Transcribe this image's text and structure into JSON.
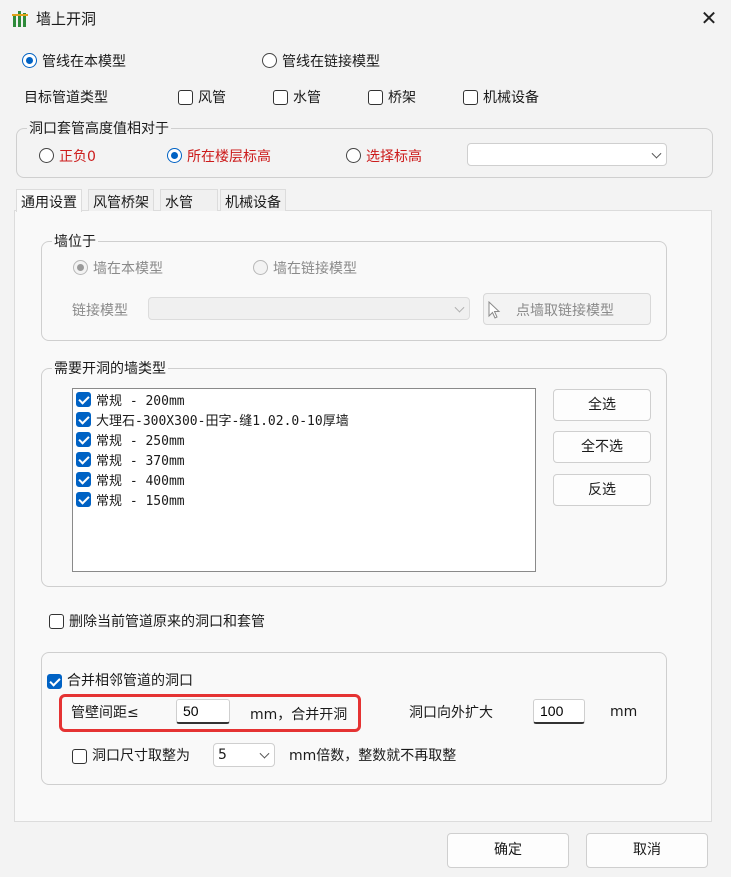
{
  "window": {
    "title": "墙上开洞"
  },
  "source": {
    "options": [
      "管线在本模型",
      "管线在链接模型"
    ],
    "selected": 0
  },
  "pipe_types": {
    "label": "目标管道类型",
    "items": [
      {
        "label": "风管",
        "checked": false
      },
      {
        "label": "水管",
        "checked": false
      },
      {
        "label": "桥架",
        "checked": false
      },
      {
        "label": "机械设备",
        "checked": false
      }
    ]
  },
  "height_ref": {
    "legend": "洞口套管高度值相对于",
    "options": [
      "正负0",
      "所在楼层标高",
      "选择标高"
    ],
    "selected": 1,
    "level_select_value": ""
  },
  "tabs": [
    "通用设置",
    "风管桥架",
    "水管",
    "机械设备"
  ],
  "active_tab": 0,
  "wall_location": {
    "legend": "墙位于",
    "options": [
      "墙在本模型",
      "墙在链接模型"
    ],
    "selected": 0,
    "link_model_label": "链接模型",
    "link_model_value": "",
    "pick_button_label": "点墙取链接模型"
  },
  "wall_types": {
    "legend": "需要开洞的墙类型",
    "items": [
      {
        "label": "常规 - 200mm",
        "checked": true
      },
      {
        "label": "大理石-300X300-田字-缝1.02.0-10厚墙",
        "checked": true
      },
      {
        "label": "常规 - 250mm",
        "checked": true
      },
      {
        "label": "常规 - 370mm",
        "checked": true
      },
      {
        "label": "常规 - 400mm",
        "checked": true
      },
      {
        "label": "常规 - 150mm",
        "checked": true
      }
    ],
    "select_all_label": "全选",
    "select_none_label": "全不选",
    "invert_label": "反选"
  },
  "delete_existing": {
    "label": "删除当前管道原来的洞口和套管",
    "checked": false
  },
  "merge": {
    "label": "合并相邻管道的洞口",
    "checked": true,
    "gap_label": "管壁间距≤",
    "gap_value": "50",
    "gap_suffix": "mm，合并开洞",
    "expand_label": "洞口向外扩大",
    "expand_value": "100",
    "expand_unit": "mm",
    "round_label": "洞口尺寸取整为",
    "round_checked": false,
    "round_value": "5",
    "round_suffix": "mm倍数，整数就不再取整"
  },
  "footer": {
    "ok_label": "确定",
    "cancel_label": "取消"
  },
  "colors": {
    "accent": "#0062c4",
    "highlight": "#e53333",
    "label_red": "#cc1b1b"
  }
}
